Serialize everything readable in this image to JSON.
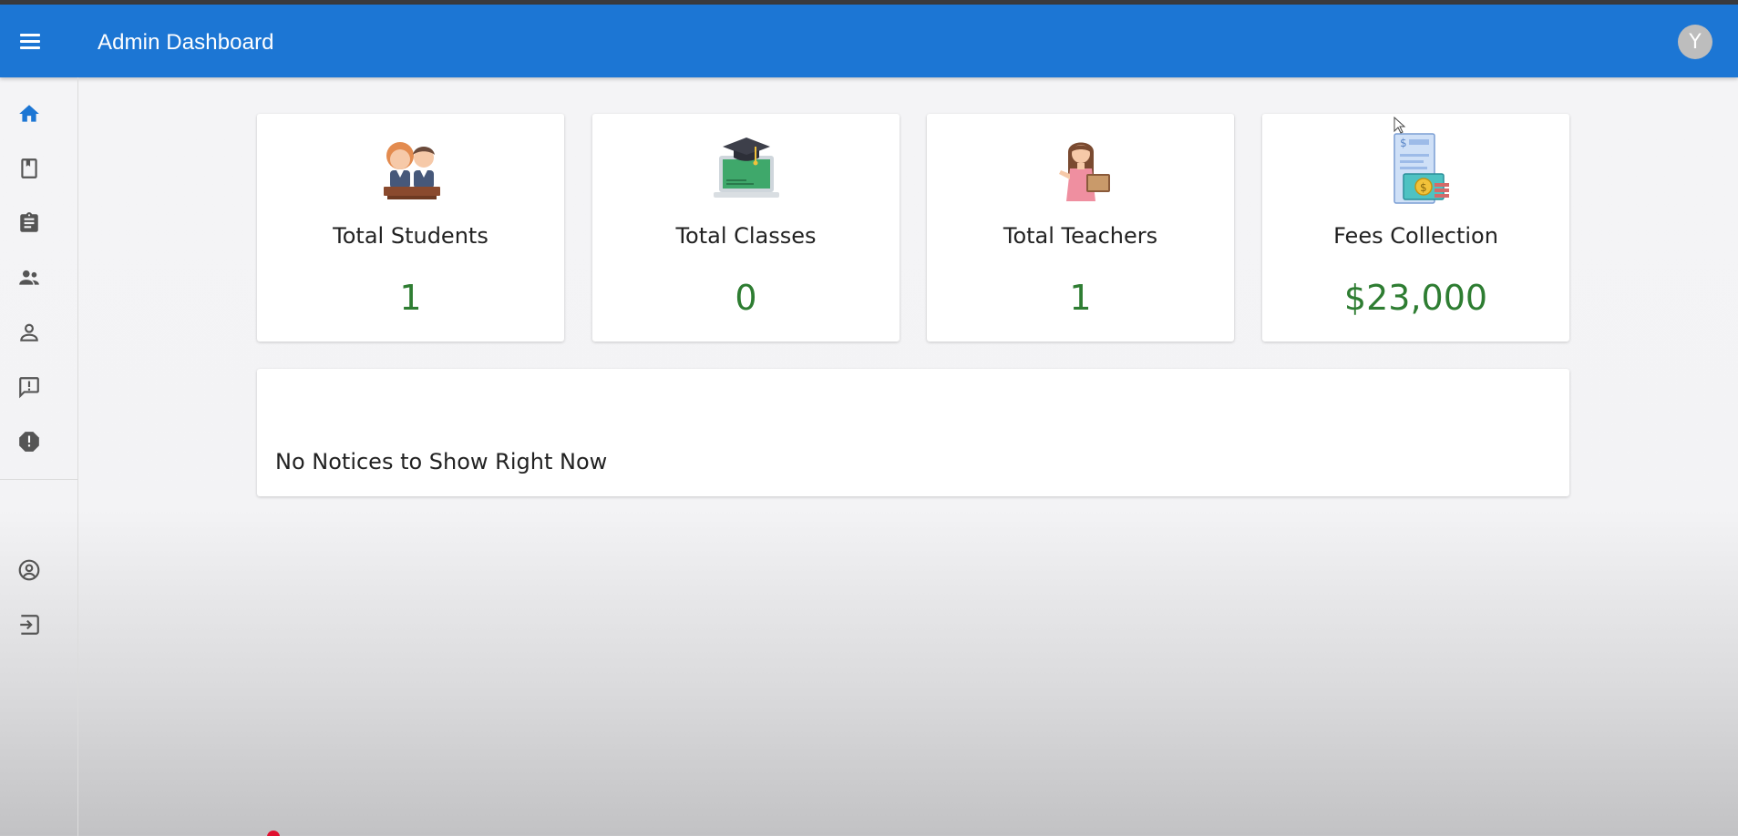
{
  "header": {
    "title": "Admin Dashboard",
    "avatar_letter": "Y",
    "menu_icon": "menu-icon",
    "accent_color": "#1c76d4"
  },
  "sidebar": {
    "items": [
      {
        "icon": "home-icon",
        "active": true
      },
      {
        "icon": "book-icon"
      },
      {
        "icon": "clipboard-icon"
      },
      {
        "icon": "group-icon"
      },
      {
        "icon": "person-icon"
      },
      {
        "icon": "feedback-icon"
      },
      {
        "icon": "report-icon"
      }
    ],
    "bottom_items": [
      {
        "icon": "account-circle-icon"
      },
      {
        "icon": "logout-icon"
      }
    ]
  },
  "stats": [
    {
      "label": "Total Students",
      "value": "1",
      "icon": "students-illustration"
    },
    {
      "label": "Total Classes",
      "value": "0",
      "icon": "classes-illustration"
    },
    {
      "label": "Total Teachers",
      "value": "1",
      "icon": "teacher-illustration"
    },
    {
      "label": "Fees Collection",
      "value": "$23,000",
      "icon": "fees-illustration"
    }
  ],
  "notice": {
    "message": "No Notices to Show Right Now"
  },
  "colors": {
    "value_green": "#2e7d32",
    "active_nav": "#1c76d4",
    "nav_icon": "#555555"
  }
}
